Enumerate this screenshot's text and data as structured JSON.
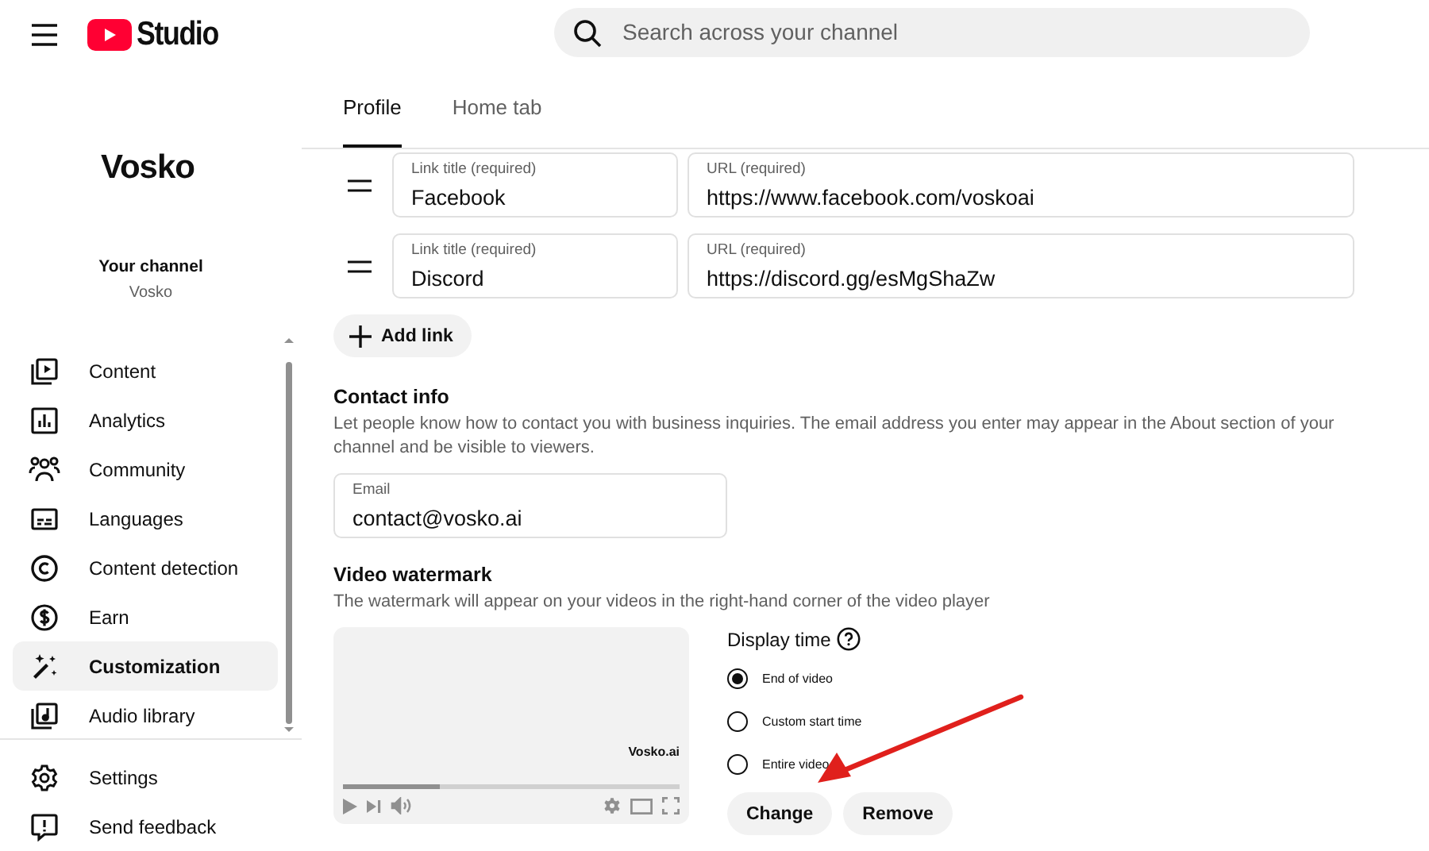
{
  "header": {
    "brand": "Studio",
    "search_placeholder": "Search across your channel"
  },
  "channel": {
    "logo": "Vosko",
    "label": "Your channel",
    "name": "Vosko"
  },
  "sidebar": {
    "items": [
      {
        "label": "Content",
        "selected": false
      },
      {
        "label": "Analytics",
        "selected": false
      },
      {
        "label": "Community",
        "selected": false
      },
      {
        "label": "Languages",
        "selected": false
      },
      {
        "label": "Content detection",
        "selected": false
      },
      {
        "label": "Earn",
        "selected": false
      },
      {
        "label": "Customization",
        "selected": true
      },
      {
        "label": "Audio library",
        "selected": false
      }
    ],
    "footer_items": [
      {
        "label": "Settings"
      },
      {
        "label": "Send feedback"
      }
    ]
  },
  "tabs": [
    {
      "label": "Profile",
      "selected": true
    },
    {
      "label": "Home tab",
      "selected": false
    }
  ],
  "links": [
    {
      "title_label": "Link title (required)",
      "title": "Facebook",
      "url_label": "URL (required)",
      "url": "https://www.facebook.com/voskoai"
    },
    {
      "title_label": "Link title (required)",
      "title": "Discord",
      "url_label": "URL (required)",
      "url": "https://discord.gg/esMgShaZw"
    }
  ],
  "add_link": "Add link",
  "contact": {
    "heading": "Contact info",
    "description": "Let people know how to contact you with business inquiries. The email address you enter may appear in the About section of your channel and be visible to viewers.",
    "email_label": "Email",
    "email": "contact@vosko.ai"
  },
  "watermark": {
    "heading": "Video watermark",
    "description": "The watermark will appear on your videos in the right-hand corner of the video player",
    "preview_logo": "Vosko.ai",
    "level": 0.29,
    "display_time_label": "Display time",
    "options": [
      {
        "label": "End of video",
        "selected": true
      },
      {
        "label": "Custom start time",
        "selected": false
      },
      {
        "label": "Entire video",
        "selected": false
      }
    ],
    "buttons": [
      "Change",
      "Remove"
    ]
  }
}
